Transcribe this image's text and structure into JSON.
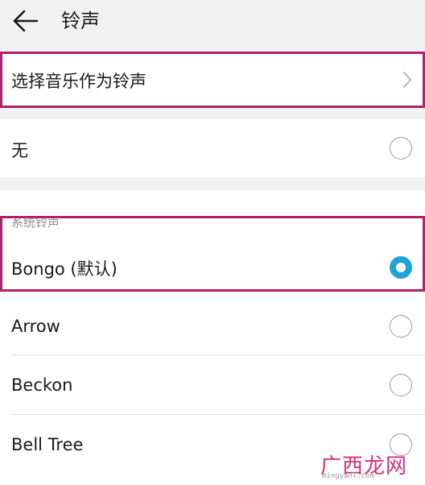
{
  "header": {
    "title": "铃声"
  },
  "pick_music": {
    "label": "选择音乐作为铃声"
  },
  "none_option": {
    "label": "无",
    "selected": false
  },
  "system_section": {
    "label": "系统铃声"
  },
  "ringtones": [
    {
      "label": "Bongo (默认)",
      "selected": true
    },
    {
      "label": "Arrow",
      "selected": false
    },
    {
      "label": "Beckon",
      "selected": false
    },
    {
      "label": "Bell Tree",
      "selected": false
    }
  ],
  "watermark": {
    "brand": "广西龙网",
    "site": "mingyanl.com"
  },
  "colors": {
    "accent": "#1ea5d6",
    "highlight": "#b0206a",
    "background": "#f2f2f2"
  }
}
